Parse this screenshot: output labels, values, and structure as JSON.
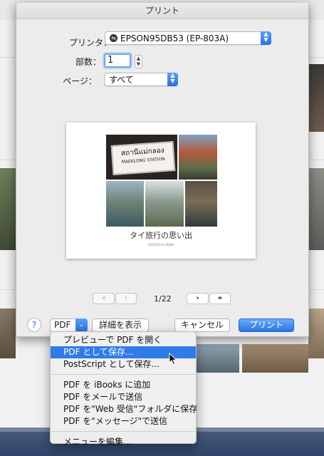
{
  "dialog": {
    "title": "プリント",
    "printer_label": "プリンタ：",
    "printer_value": "EPSON95DB53 (EP-803A)",
    "copies_label": "部数：",
    "copies_value": "1",
    "pages_label": "ページ：",
    "pages_value": "すべて"
  },
  "preview": {
    "album_title": "タイ旅行の思い出",
    "album_date": "2015/01/15 00/06",
    "sign_text_line1": "สถานีแม่กลอง",
    "sign_text_line2": "MAEKLONG STATION"
  },
  "pager": {
    "first_label": "«",
    "prev_label": "‹",
    "page_indicator": "1/22",
    "next_label": "›",
    "last_label": "»"
  },
  "buttons": {
    "help_label": "?",
    "pdf_label": "PDF",
    "details_label": "詳細を表示",
    "cancel_label": "キャンセル",
    "print_label": "プリント"
  },
  "pdf_menu": {
    "group1": [
      "プレビューで PDF を開く",
      "PDF として保存...",
      "PostScript として保存..."
    ],
    "group2": [
      "PDF を iBooks に追加",
      "PDF をメールで送信",
      "PDF を\"Web 受信\"フォルダに保存",
      "PDF を\"メッセージ\"で送信"
    ],
    "group3": [
      "メニューを編集..."
    ],
    "highlighted": "PDF として保存..."
  },
  "colors": {
    "accent": "#2f7ce8",
    "sheet_background": "#ececec"
  }
}
